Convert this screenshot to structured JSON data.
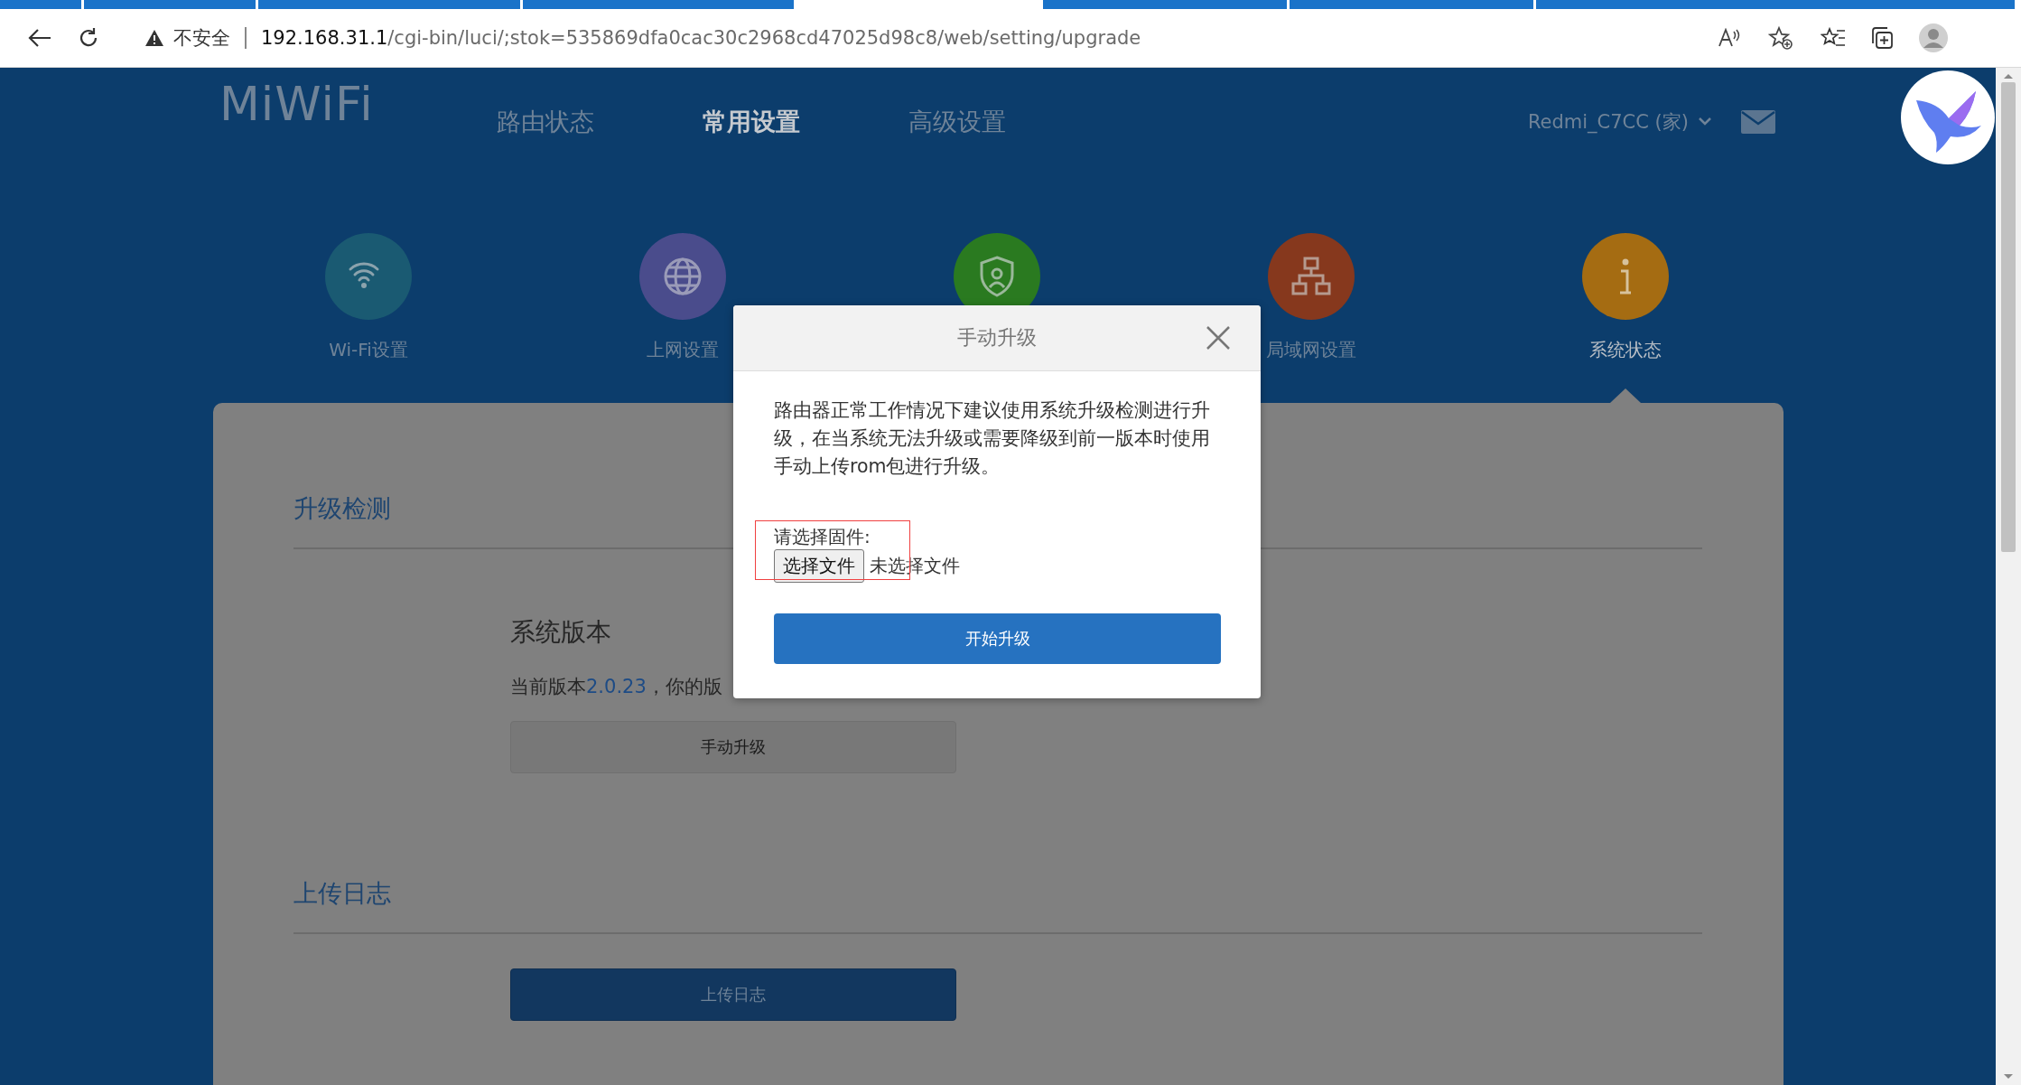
{
  "browser": {
    "security": "不安全",
    "url_host": "192.168.31.1",
    "url_path": "/cgi-bin/luci/;stok=535869dfa0cac30c2968cd47025d98c8/web/setting/upgrade"
  },
  "header": {
    "logo": "MiWiFi",
    "nav": [
      {
        "label": "路由状态",
        "selected": false
      },
      {
        "label": "常用设置",
        "selected": true
      },
      {
        "label": "高级设置",
        "selected": false
      }
    ],
    "device": "Redmi_C7CC (家)"
  },
  "features": [
    {
      "label": "Wi-Fi设置",
      "selected": false
    },
    {
      "label": "上网设置",
      "selected": false
    },
    {
      "selected": false
    },
    {
      "label": "局域网设置",
      "selected": false
    },
    {
      "label": "系统状态",
      "selected": true
    }
  ],
  "upgrade_check": {
    "heading": "升级检测",
    "version_title": "系统版本",
    "version_prefix": "当前版本",
    "version": "2.0.23",
    "version_suffix": "，你的版",
    "manual_button": "手动升级"
  },
  "upload_log": {
    "heading": "上传日志",
    "button": "上传日志"
  },
  "modal": {
    "title": "手动升级",
    "description": "路由器正常工作情况下建议使用系统升级检测进行升级，在当系统无法升级或需要降级到前一版本时使用手动上传rom包进行升级。",
    "file_label": "请选择固件:",
    "file_button": "选择文件",
    "file_status": "未选择文件",
    "submit": "开始升级"
  }
}
